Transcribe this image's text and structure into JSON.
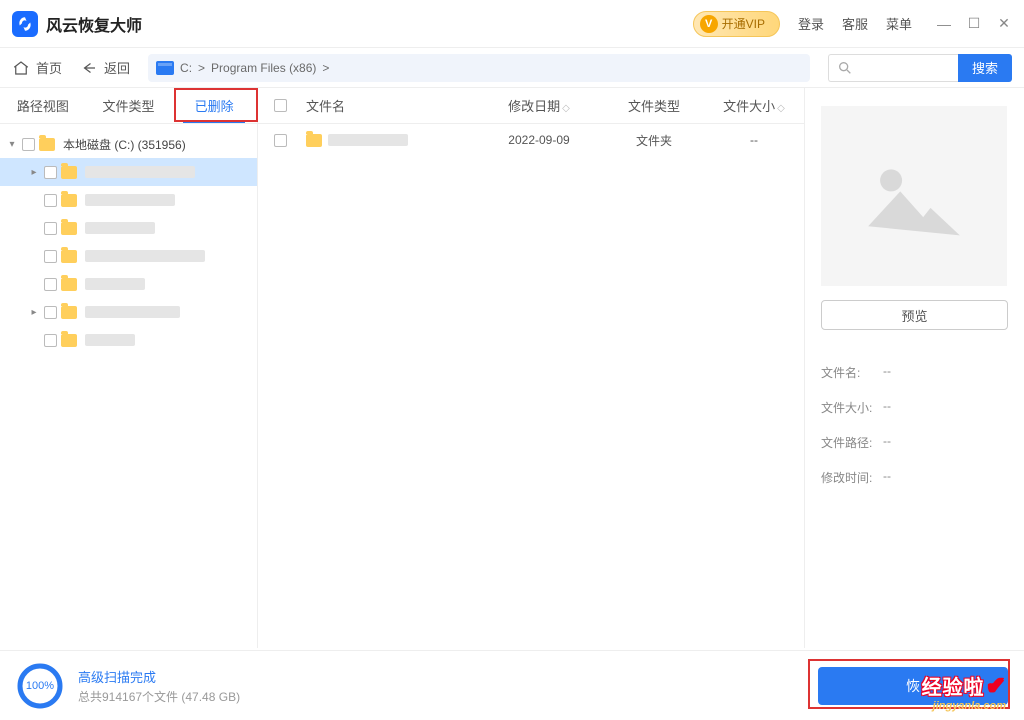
{
  "titlebar": {
    "app_name": "风云恢复大师",
    "vip_label": "开通VIP",
    "vip_badge": "V",
    "login": "登录",
    "support": "客服",
    "menu": "菜单"
  },
  "nav": {
    "home": "首页",
    "back": "返回",
    "breadcrumb": [
      "C:",
      ">",
      "Program Files (x86)",
      ">"
    ],
    "search_btn": "搜索"
  },
  "tabs": {
    "path_view": "路径视图",
    "file_type": "文件类型",
    "deleted": "已删除"
  },
  "tree": {
    "root_label": "本地磁盘 (C:) (351956)",
    "children_count": 7
  },
  "list": {
    "headers": {
      "name": "文件名",
      "date": "修改日期",
      "type": "文件类型",
      "size": "文件大小"
    },
    "rows": [
      {
        "name": "",
        "date": "2022-09-09",
        "type": "文件夹",
        "size": "--"
      }
    ]
  },
  "right": {
    "preview_btn": "预览",
    "details": {
      "name_label": "文件名:",
      "name_value": "--",
      "size_label": "文件大小:",
      "size_value": "--",
      "path_label": "文件路径:",
      "path_value": "--",
      "mtime_label": "修改时间:",
      "mtime_value": "--"
    }
  },
  "footer": {
    "progress": "100%",
    "scan_title": "高级扫描完成",
    "scan_sub": "总共914167个文件 (47.48 GB)",
    "recover_btn": "恢"
  },
  "watermark": {
    "line1": "经验啦",
    "line2": "jingyanla.com"
  }
}
